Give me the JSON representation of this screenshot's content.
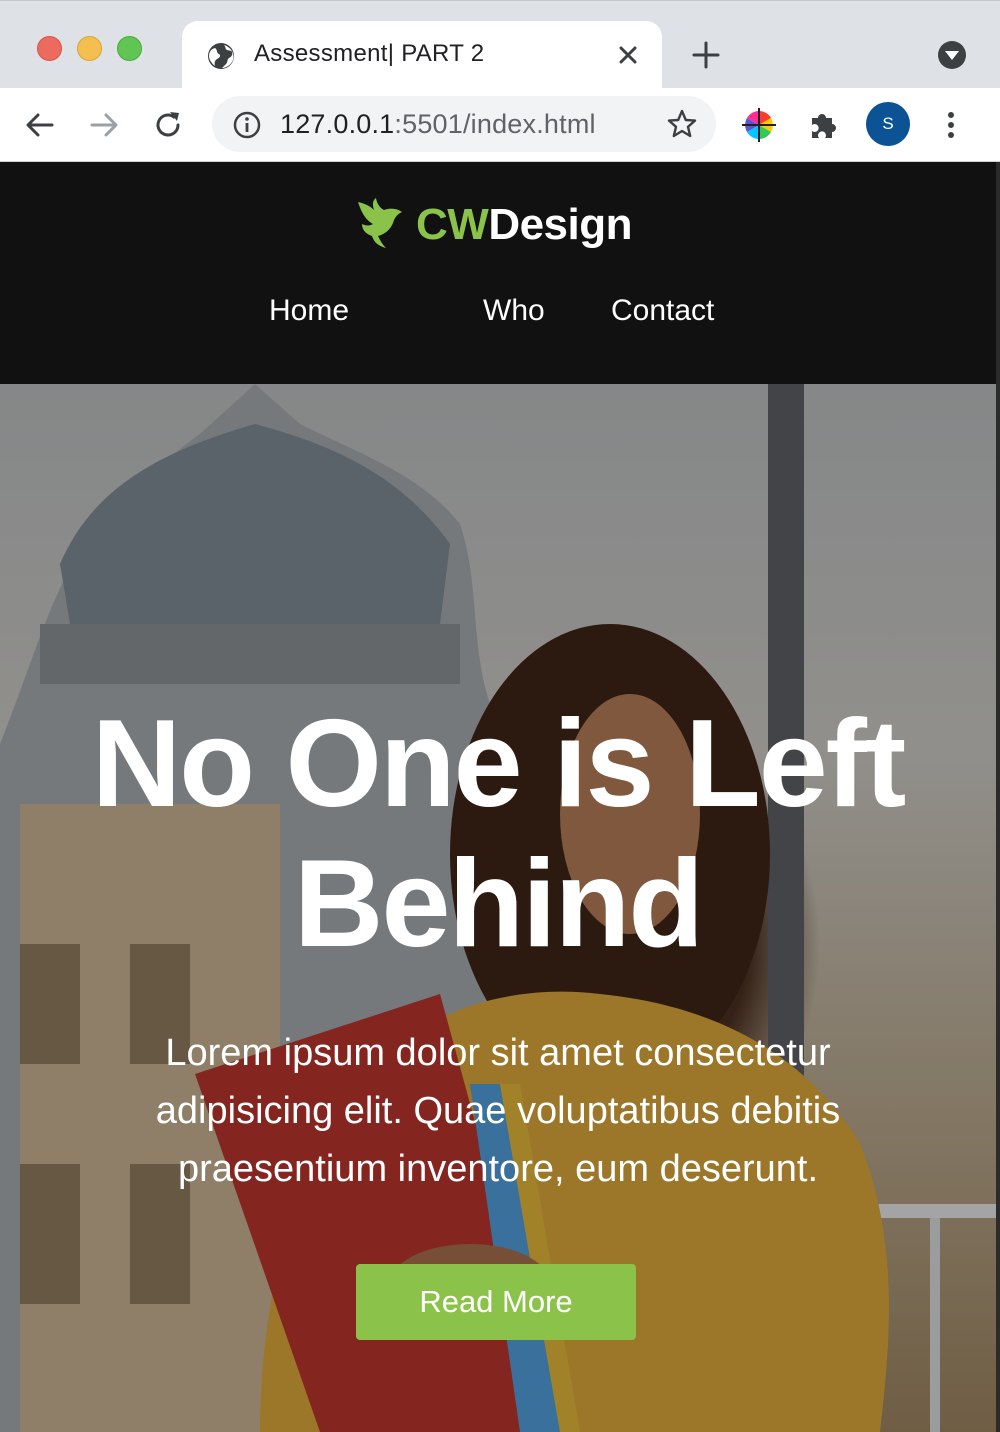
{
  "browser": {
    "tab_title": "Assessment| PART 2",
    "url_host": "127.0.0.1",
    "url_rest": ":5501/index.html",
    "profile_initial": "S",
    "colors": {
      "tab_bar": "#dee1e6",
      "omnibox": "#f1f3f4",
      "avatar": "#0b5394"
    }
  },
  "site": {
    "logo_cw": "CW",
    "logo_design": "Design",
    "nav": [
      "Home",
      "Who",
      "Contact"
    ],
    "colors": {
      "header_bg": "#111111",
      "brand_green": "#8bc34a"
    }
  },
  "hero": {
    "title_line1": "No One is Left",
    "title_line2": "Behind",
    "text_line1": "Lorem ipsum dolor sit amet consectetur",
    "text_line2": "adipisicing elit. Quae voluptatibus debitis",
    "text_line3": "praesentium inventore, eum deserunt.",
    "button_label": "Read More"
  }
}
